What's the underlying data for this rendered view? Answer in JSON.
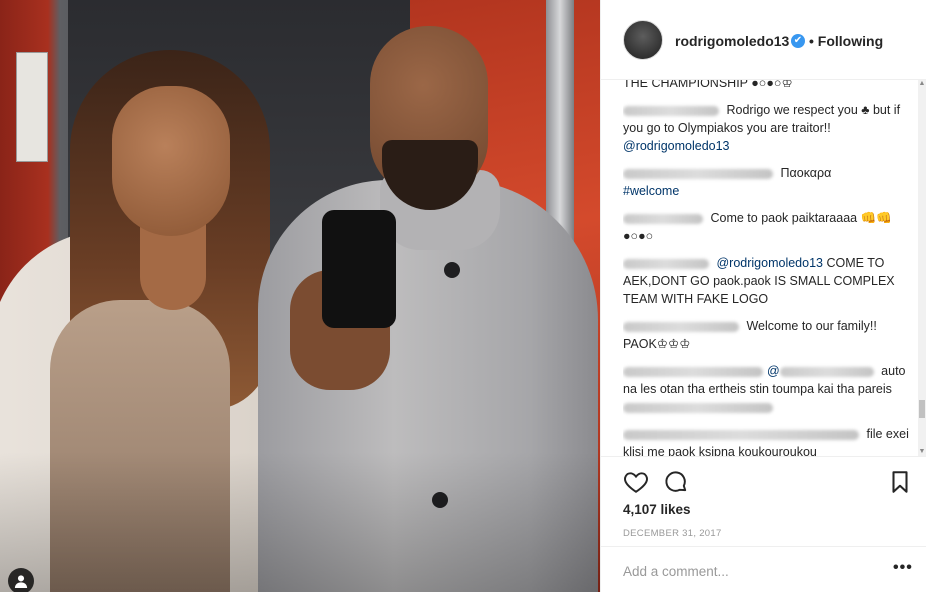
{
  "post": {
    "username": "rodrigomoledo13",
    "verified_badge": "✔",
    "separator": "•",
    "follow_status": "Following"
  },
  "comments": [
    {
      "text": "THE CHAMPIONSHIP ●○●○♔"
    },
    {
      "pre": "Rodrigo we respect you ♣ but if you go to Olympiakos you are traitor!! ",
      "mention": "@rodrigomoledo13"
    },
    {
      "text": "Παοκαρα",
      "hashtag": "#welcome"
    },
    {
      "text": "Come to paok paiktaraaaa 👊👊 ●○●○"
    },
    {
      "mention": "@rodrigomoledo13",
      "post": " COME TO AEK,DONT GO paok.paok IS SMALL COMPLEX TEAM WITH FAKE LOGO"
    },
    {
      "text": "Welcome to our family!! PAOK♔♔♔"
    },
    {
      "mention": "@",
      "post": " auto na les otan tha ertheis stin toumpa kai tha pareis"
    },
    {
      "pre": "file exei klisi me paok ksipna koukouroukou"
    }
  ],
  "actions": {
    "like_icon": "heart-icon",
    "comment_icon": "comment-bubble-icon",
    "save_icon": "bookmark-icon"
  },
  "likes": "4,107 likes",
  "date": "December 31, 2017",
  "add_comment": {
    "placeholder": "Add a comment..."
  },
  "more_label": "•••",
  "colors": {
    "link": "#003569",
    "verified": "#3897f0",
    "muted": "#999999"
  }
}
